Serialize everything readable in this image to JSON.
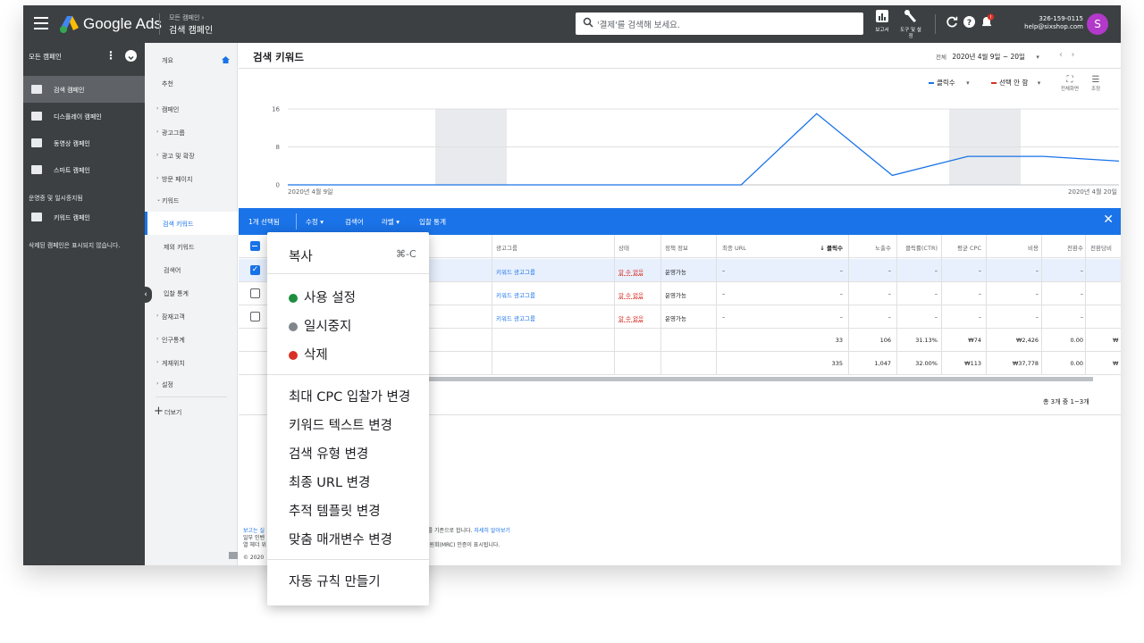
{
  "app": {
    "brand": "Google Ads"
  },
  "breadcrumb": {
    "parent": "모든 캠페인 ›",
    "current": "검색 캠페인"
  },
  "search": {
    "placeholder": "'결제'를 검색해 보세요."
  },
  "tools": [
    {
      "icon": "bar-chart-icon",
      "label": "보고서"
    },
    {
      "icon": "wrench-icon",
      "label": "도구 및 설정"
    }
  ],
  "account": {
    "id": "326-159-0115",
    "email": "help@sixshop.com",
    "avatar_letter": "S"
  },
  "left_sidebar": {
    "header": "모든 캠페인",
    "items": [
      {
        "label": "검색 캠페인",
        "icon": "search-campaign-icon",
        "selected": true
      },
      {
        "label": "디스플레이 캠페인",
        "icon": "display-campaign-icon",
        "selected": false
      },
      {
        "label": "동영상 캠페인",
        "icon": "video-campaign-icon",
        "selected": false
      },
      {
        "label": "스마트 캠페인",
        "icon": "smart-campaign-icon",
        "selected": false
      }
    ],
    "section_label": "운영중 및 일시중지됨",
    "keyword_campaign": "키워드 캠페인",
    "deleted_note": "삭제된 캠페인은 표시되지 않습니다."
  },
  "nav": {
    "items": [
      {
        "label": "개요",
        "caret": "",
        "selected": false
      },
      {
        "label": "추천",
        "caret": "",
        "selected": false
      },
      {
        "label": "캠페인",
        "caret": "›",
        "selected": false
      },
      {
        "label": "광고그룹",
        "caret": "›",
        "selected": false
      },
      {
        "label": "광고 및 확장",
        "caret": "›",
        "selected": false
      },
      {
        "label": "방문 페이지",
        "caret": "›",
        "selected": false
      },
      {
        "label": "키워드",
        "caret": "⌄",
        "selected": false
      },
      {
        "label": "검색 키워드",
        "caret": "",
        "selected": true
      },
      {
        "label": "제외 키워드",
        "caret": "",
        "selected": false
      },
      {
        "label": "검색어",
        "caret": "",
        "selected": false
      },
      {
        "label": "입찰 통계",
        "caret": "",
        "selected": false
      },
      {
        "label": "잠재고객",
        "caret": "›",
        "selected": false
      },
      {
        "label": "인구통계",
        "caret": "›",
        "selected": false
      },
      {
        "label": "게재위치",
        "caret": "›",
        "selected": false
      },
      {
        "label": "설정",
        "caret": "›",
        "selected": false
      }
    ],
    "more": "더보기"
  },
  "page": {
    "title": "검색 키워드",
    "date_prefix": "전체",
    "date_range": "2020년 4월 9일 ~ 20일"
  },
  "chart_data": {
    "type": "line",
    "series": [
      {
        "name": "클릭수",
        "values": [
          0,
          0,
          0,
          0,
          0,
          0,
          0,
          15,
          2,
          6,
          6,
          5
        ]
      }
    ],
    "x_start_label": "2020년 4월 9일",
    "x_end_label": "2020년 4월 20일",
    "yticks": [
      0,
      8,
      16
    ],
    "ylim": [
      0,
      16
    ],
    "second_metric": "선택 안 함",
    "controls": [
      "전체화면",
      "조정"
    ]
  },
  "action_bar": {
    "selected": "1개 선택됨",
    "edit": "수정",
    "search_terms": "검색어",
    "label": "라벨",
    "auction": "입찰 통계"
  },
  "table": {
    "columns": {
      "adgroup": "광고그룹",
      "status": "상태",
      "policy": "정책 정보",
      "final_url": "최종 URL",
      "clicks": "↓ 클릭수",
      "impr": "노출수",
      "ctr": "클릭률(CTR)",
      "cpc": "평균 CPC",
      "cost": "비용",
      "conv": "전환수",
      "cost_conv": "전환당비"
    },
    "rows": [
      {
        "adgroup": "키워드 광고그룹",
        "status": "알 수 없음",
        "policy": "운영가능",
        "url": "–",
        "clicks": "–",
        "impr": "–",
        "ctr": "–",
        "cpc": "–",
        "cost": "–",
        "conv": "–",
        "checked": true
      },
      {
        "adgroup": "키워드 광고그룹",
        "status": "알 수 없음",
        "policy": "운영가능",
        "url": "–",
        "clicks": "–",
        "impr": "–",
        "ctr": "–",
        "cpc": "–",
        "cost": "–",
        "conv": "–",
        "checked": false
      },
      {
        "adgroup": "키워드 광고그룹",
        "status": "알 수 없음",
        "policy": "운영가능",
        "url": "–",
        "clicks": "–",
        "impr": "–",
        "ctr": "–",
        "cpc": "–",
        "cost": "–",
        "conv": "–",
        "checked": false
      }
    ],
    "totals": [
      {
        "clicks": "33",
        "impr": "106",
        "ctr": "31.13%",
        "cpc": "₩74",
        "cost": "₩2,426",
        "conv": "0.00",
        "cost_conv": "₩"
      },
      {
        "clicks": "335",
        "impr": "1,047",
        "ctr": "32.00%",
        "cpc": "₩113",
        "cost": "₩37,778",
        "conv": "0.00",
        "cost_conv": "₩"
      }
    ],
    "pager": "총 3개 중 1~3개"
  },
  "footer": {
    "line1": "보고는 실",
    "line1_tail": "표준시를 기준으로 합니다.",
    "learn_more": "자세히 알아보기",
    "line2": "일부 인벤",
    "line3": "열 헤더 위",
    "line3_tail": "인증 위원회(MRC) 인증이 표시됩니다.",
    "copyright": "© 2020"
  },
  "context_menu": {
    "copy": "복사",
    "copy_shortcut": "⌘-C",
    "enable": "사용 설정",
    "pause": "일시중지",
    "remove": "삭제",
    "change_cpc": "최대 CPC 입찰가 변경",
    "change_text": "키워드 텍스트 변경",
    "change_match": "검색 유형 변경",
    "change_url": "최종 URL 변경",
    "change_template": "추적 템플릿 변경",
    "change_params": "맞춤 매개변수 변경",
    "create_rule": "자동 규칙 만들기",
    "colors": {
      "enable": "#1e8e3e",
      "pause": "#80868b",
      "remove": "#d93025"
    }
  },
  "colors": {
    "accent": "#1a73e8",
    "dark": "#3c4043",
    "chart_line": "#1a73e8",
    "second_metric": "#d93025"
  }
}
